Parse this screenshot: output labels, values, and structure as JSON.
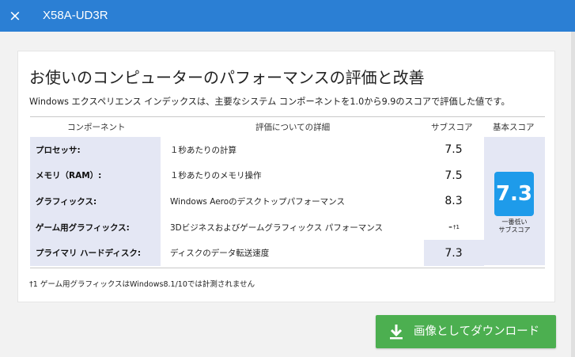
{
  "window": {
    "title": "X58A-UD3R",
    "close_icon": "×",
    "accent_color": "#2b7fd4"
  },
  "panel": {
    "heading": "お使いのコンピューターのパフォーマンスの評価と改善",
    "description": "Windows エクスペリエンス インデックスは、主要なシステム コンポーネントを1.0から9.9のスコアで評価した値です。",
    "columns": {
      "component": "コンポーネント",
      "detail": "評価についての詳細",
      "subscore": "サブスコア",
      "base": "基本スコア"
    },
    "rows": [
      {
        "component": "プロセッサ:",
        "detail": "１秒あたりの計算",
        "subscore": "7.5",
        "note": ""
      },
      {
        "component": "メモリ（RAM）:",
        "detail": "１秒あたりのメモリ操作",
        "subscore": "7.5",
        "note": ""
      },
      {
        "component": "グラフィックス:",
        "detail": "Windows Aeroのデスクトップパフォーマンス",
        "subscore": "8.3",
        "note": ""
      },
      {
        "component": "ゲーム用グラフィックス:",
        "detail": "3Dビジネスおよびゲームグラフィックス パフォーマンス",
        "subscore": "-",
        "note": "†1"
      },
      {
        "component": "プライマリ ハードディスク:",
        "detail": "ディスクのデータ転送速度",
        "subscore": "7.3",
        "note": ""
      }
    ],
    "base_score": "7.3",
    "base_caption_line1": "一番低い",
    "base_caption_line2": "サブスコア",
    "badge_color": "#1e9bea",
    "footnote": "†1 ゲーム用グラフィックスはWindows8.1/10では計測されません"
  },
  "download": {
    "label": "画像としてダウンロード",
    "icon": "download-icon",
    "color": "#4caf50"
  }
}
